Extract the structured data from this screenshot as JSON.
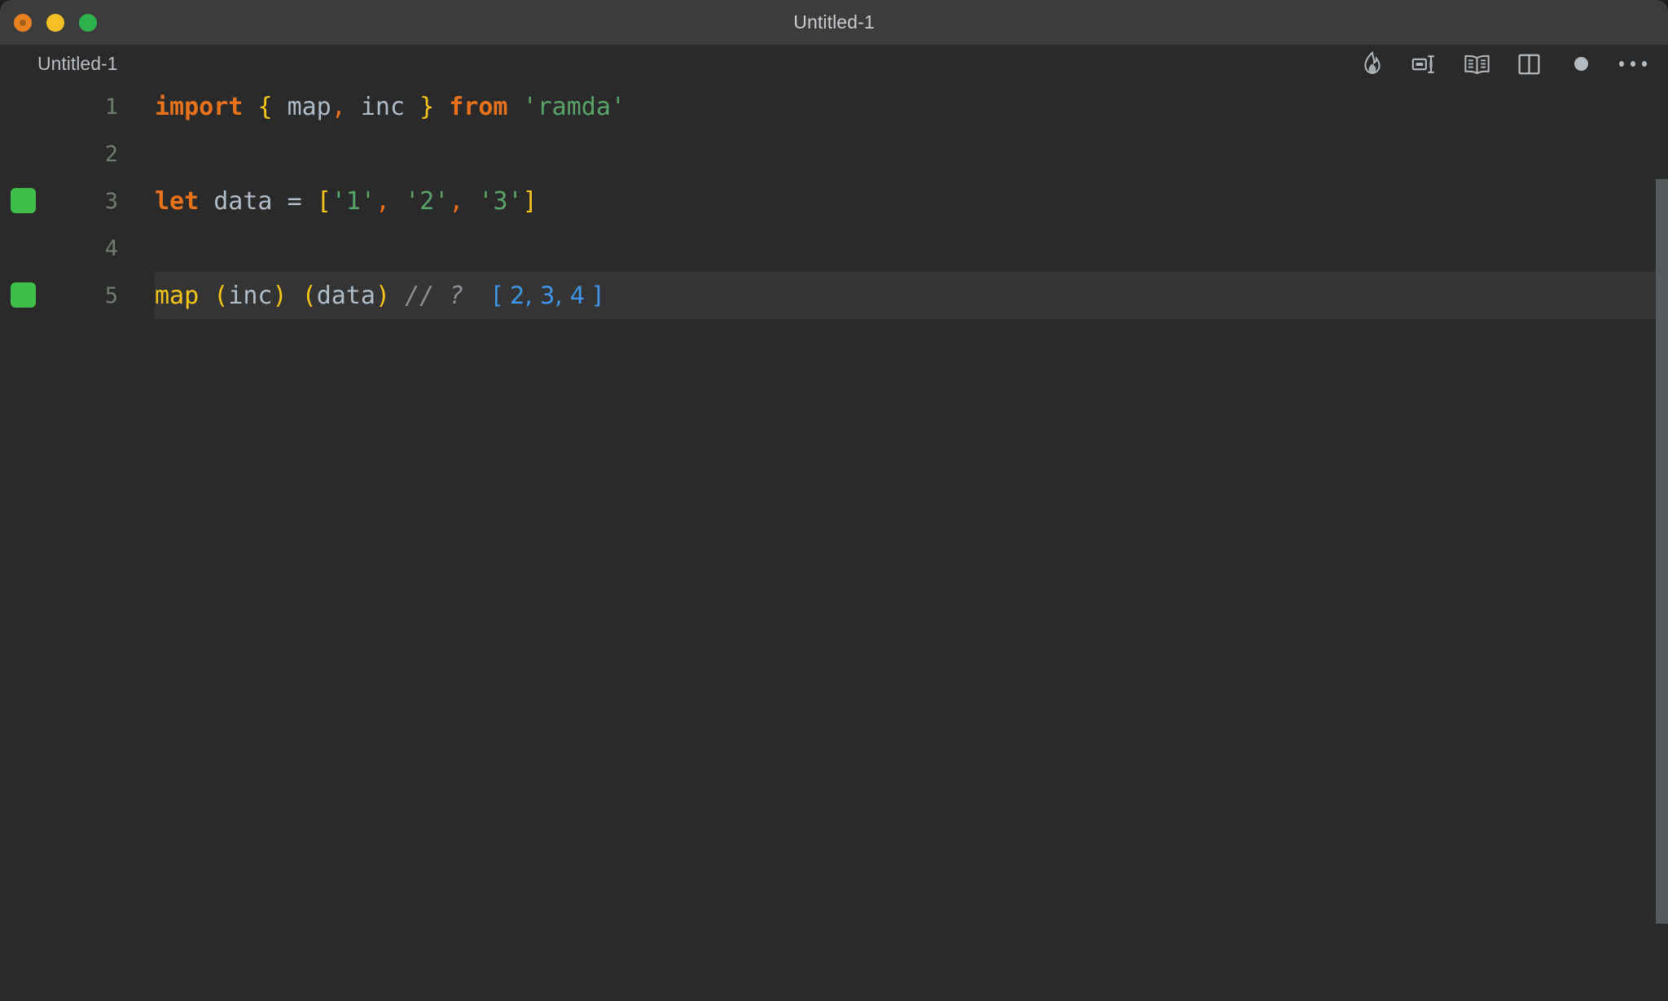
{
  "window": {
    "title": "Untitled-1",
    "traffic_lights": [
      "close-orange",
      "minimize-yellow",
      "maximize-green"
    ]
  },
  "topbar": {
    "breadcrumb": "Untitled-1",
    "actions": [
      {
        "name": "quokka-flame-icon",
        "label": "Quokka"
      },
      {
        "name": "open-to-the-side-icon",
        "label": "Open to the Side"
      },
      {
        "name": "open-preview-book-icon",
        "label": "Open Preview"
      },
      {
        "name": "split-editor-icon",
        "label": "Split Editor"
      },
      {
        "name": "unsaved-dot-icon",
        "label": "Unsaved changes"
      },
      {
        "name": "more-actions-ellipsis-icon",
        "label": "More Actions..."
      }
    ]
  },
  "editor": {
    "language": "javascript",
    "active_line": 5,
    "lines": [
      {
        "number": "1",
        "marker": false,
        "active": false,
        "tokens": [
          {
            "cls": "t-kw",
            "text": "import"
          },
          {
            "cls": "t-plain",
            "text": " "
          },
          {
            "cls": "t-brace",
            "text": "{"
          },
          {
            "cls": "t-plain",
            "text": " "
          },
          {
            "cls": "t-var",
            "text": "map"
          },
          {
            "cls": "t-punc",
            "text": ","
          },
          {
            "cls": "t-plain",
            "text": " "
          },
          {
            "cls": "t-var",
            "text": "inc"
          },
          {
            "cls": "t-plain",
            "text": " "
          },
          {
            "cls": "t-brace",
            "text": "}"
          },
          {
            "cls": "t-plain",
            "text": " "
          },
          {
            "cls": "t-kw",
            "text": "from"
          },
          {
            "cls": "t-plain",
            "text": " "
          },
          {
            "cls": "t-str",
            "text": "'ramda'"
          }
        ]
      },
      {
        "number": "2",
        "marker": false,
        "active": false,
        "tokens": []
      },
      {
        "number": "3",
        "marker": true,
        "active": false,
        "tokens": [
          {
            "cls": "t-kw",
            "text": "let"
          },
          {
            "cls": "t-plain",
            "text": " "
          },
          {
            "cls": "t-var",
            "text": "data"
          },
          {
            "cls": "t-plain",
            "text": " "
          },
          {
            "cls": "t-var",
            "text": "="
          },
          {
            "cls": "t-plain",
            "text": " "
          },
          {
            "cls": "t-brkt",
            "text": "["
          },
          {
            "cls": "t-str",
            "text": "'1'"
          },
          {
            "cls": "t-punc",
            "text": ","
          },
          {
            "cls": "t-plain",
            "text": " "
          },
          {
            "cls": "t-str",
            "text": "'2'"
          },
          {
            "cls": "t-punc",
            "text": ","
          },
          {
            "cls": "t-plain",
            "text": " "
          },
          {
            "cls": "t-str",
            "text": "'3'"
          },
          {
            "cls": "t-brkt",
            "text": "]"
          }
        ]
      },
      {
        "number": "4",
        "marker": false,
        "active": false,
        "tokens": []
      },
      {
        "number": "5",
        "marker": true,
        "active": true,
        "tokens": [
          {
            "cls": "t-fn",
            "text": "map"
          },
          {
            "cls": "t-plain",
            "text": " "
          },
          {
            "cls": "t-paren",
            "text": "("
          },
          {
            "cls": "t-var",
            "text": "inc"
          },
          {
            "cls": "t-paren",
            "text": ")"
          },
          {
            "cls": "t-plain",
            "text": " "
          },
          {
            "cls": "t-paren",
            "text": "("
          },
          {
            "cls": "t-var",
            "text": "data"
          },
          {
            "cls": "t-paren",
            "text": ")"
          },
          {
            "cls": "t-plain",
            "text": " "
          },
          {
            "cls": "t-comment",
            "text": "// ?"
          },
          {
            "cls": "t-plain",
            "text": "  "
          },
          {
            "cls": "t-result",
            "text": "[ 2, 3, 4 ]"
          }
        ]
      }
    ]
  },
  "colors": {
    "titlebar_bg": "#3c3c3c",
    "editor_bg": "#2a2a2a",
    "active_line_bg": "#343434",
    "keyword": "#e8721c",
    "string": "#5aa469",
    "bracket": "#f5c518",
    "variable": "#b0bcc8",
    "comment": "#8a8f94",
    "result_value": "#3d96e8",
    "coverage_marker": "#3fbf4a",
    "linenumber": "#6f7d6f"
  }
}
